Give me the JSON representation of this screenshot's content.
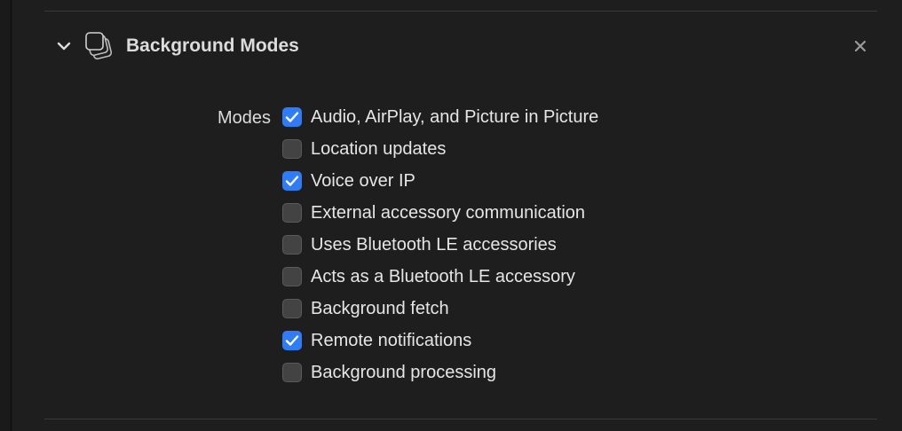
{
  "capability": {
    "title": "Background Modes",
    "expanded": true,
    "chevron_icon": "chevron-down-icon",
    "capability_icon": "background-modes-icon",
    "close_icon": "close-icon"
  },
  "modes": {
    "label": "Modes",
    "accent_color": "#2f7cf6",
    "options": [
      {
        "label": "Audio, AirPlay, and Picture in Picture",
        "checked": true
      },
      {
        "label": "Location updates",
        "checked": false
      },
      {
        "label": "Voice over IP",
        "checked": true
      },
      {
        "label": "External accessory communication",
        "checked": false
      },
      {
        "label": "Uses Bluetooth LE accessories",
        "checked": false
      },
      {
        "label": "Acts as a Bluetooth LE accessory",
        "checked": false
      },
      {
        "label": "Background fetch",
        "checked": false
      },
      {
        "label": "Remote notifications",
        "checked": true
      },
      {
        "label": "Background processing",
        "checked": false
      }
    ]
  }
}
